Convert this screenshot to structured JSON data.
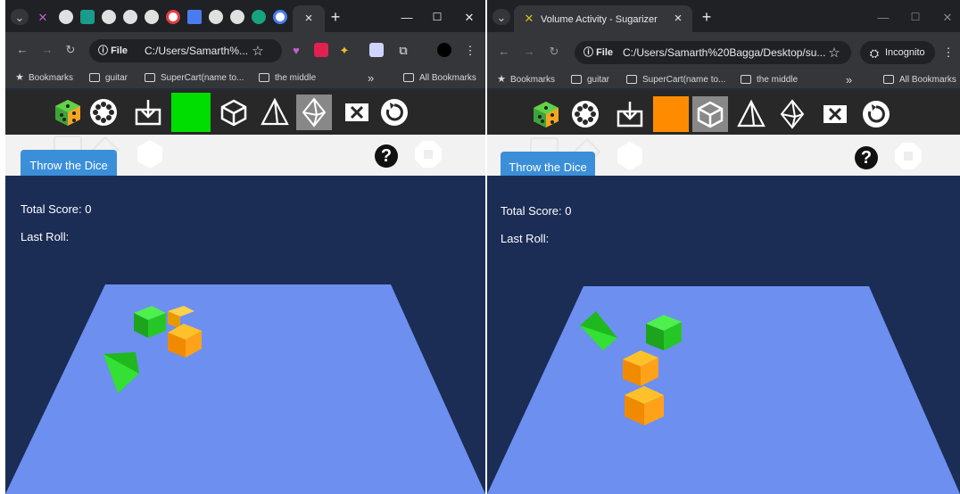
{
  "left": {
    "tab_close": "×",
    "new_tab": "+",
    "window_controls": {
      "minimize": "—",
      "maximize": "☐",
      "close": "✕"
    },
    "address": {
      "file_chip": "File",
      "url": "C:/Users/Samarth%..."
    },
    "bookmarks": [
      {
        "label": "Bookmarks",
        "icon": "star-icon"
      },
      {
        "label": "guitar",
        "icon": "folder-icon"
      },
      {
        "label": "SuperCart(name to...",
        "icon": "folder-icon"
      },
      {
        "label": "the middle",
        "icon": "folder-icon"
      }
    ],
    "bookmarks_overflow": "»",
    "all_bookmarks": "All Bookmarks",
    "toolbar_color": "#00dd00",
    "throw_button": "Throw the Dice",
    "help": "?",
    "total_score": "Total Score: 0",
    "last_roll": "Last Roll:"
  },
  "right": {
    "tab_title": "Volume Activity - Sugarizer",
    "tab_close": "×",
    "new_tab": "+",
    "window_controls": {
      "minimize": "—",
      "maximize": "☐",
      "close": "✕"
    },
    "address": {
      "file_chip": "File",
      "url": "C:/Users/Samarth%20Bagga/Desktop/su..."
    },
    "incognito": "Incognito",
    "bookmarks": [
      {
        "label": "Bookmarks",
        "icon": "star-icon"
      },
      {
        "label": "guitar",
        "icon": "folder-icon"
      },
      {
        "label": "SuperCart(name to...",
        "icon": "folder-icon"
      },
      {
        "label": "the middle",
        "icon": "folder-icon"
      }
    ],
    "bookmarks_overflow": "»",
    "all_bookmarks": "All Bookmarks",
    "toolbar_color": "#ff8c00",
    "throw_button": "Throw the Dice",
    "help": "?",
    "total_score": "Total Score: 0",
    "last_roll": "Last Roll:"
  },
  "colors": {
    "canvas_bg": "#1b2c55",
    "floor": "#6d8ff0",
    "dice_green": "#22dd22",
    "dice_orange": "#ffa500",
    "button_blue": "#3b8fd8"
  }
}
